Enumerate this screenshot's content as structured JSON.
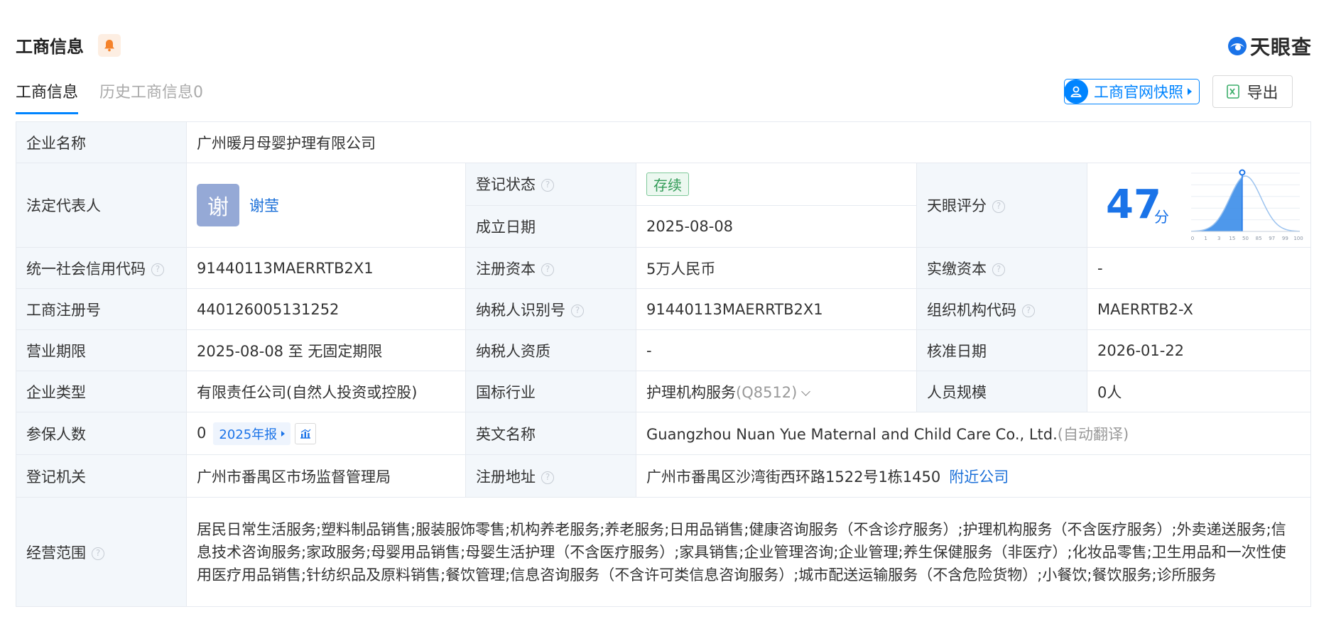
{
  "header": {
    "title": "工商信息",
    "brand": "天眼查"
  },
  "tabs": [
    {
      "label": "工商信息",
      "active": true
    },
    {
      "label": "历史工商信息0",
      "active": false
    }
  ],
  "actions": {
    "snapshot_label": "工商官网快照",
    "export_label": "导出"
  },
  "info": {
    "company_name": {
      "label": "企业名称",
      "value": "广州暖月母婴护理有限公司"
    },
    "legal_rep": {
      "label": "法定代表人",
      "avatar": "谢",
      "name": "谢莹"
    },
    "reg_status": {
      "label": "登记状态",
      "value": "存续"
    },
    "founded": {
      "label": "成立日期",
      "value": "2025-08-08"
    },
    "tianyan_score": {
      "label": "天眼评分",
      "value": "47",
      "unit": "分"
    },
    "credit_code": {
      "label": "统一社会信用代码",
      "value": "91440113MAERRTB2X1"
    },
    "reg_capital": {
      "label": "注册资本",
      "value": "5万人民币"
    },
    "paid_capital": {
      "label": "实缴资本",
      "value": "-"
    },
    "biz_reg_no": {
      "label": "工商注册号",
      "value": "440126005131252"
    },
    "taxpayer_id": {
      "label": "纳税人识别号",
      "value": "91440113MAERRTB2X1"
    },
    "org_code": {
      "label": "组织机构代码",
      "value": "MAERRTB2-X"
    },
    "biz_term": {
      "label": "营业期限",
      "value": "2025-08-08 至 无固定期限"
    },
    "taxpayer_qual": {
      "label": "纳税人资质",
      "value": "-"
    },
    "approval_date": {
      "label": "核准日期",
      "value": "2026-01-22"
    },
    "company_type": {
      "label": "企业类型",
      "value": "有限责任公司(自然人投资或控股)"
    },
    "industry": {
      "label": "国标行业",
      "value": "护理机构服务",
      "code": "(Q8512)"
    },
    "staff_size": {
      "label": "人员规模",
      "value": "0人"
    },
    "insured": {
      "label": "参保人数",
      "value": "0",
      "year_tag": "2025年报"
    },
    "english_name": {
      "label": "英文名称",
      "value": "Guangzhou Nuan Yue Maternal and Child Care Co., Ltd.",
      "note": "(自动翻译)"
    },
    "reg_authority": {
      "label": "登记机关",
      "value": "广州市番禺区市场监督管理局"
    },
    "reg_address": {
      "label": "注册地址",
      "value": "广州市番禺区沙湾街西环路1522号1栋1450",
      "link": "附近公司"
    },
    "biz_scope": {
      "label": "经营范围",
      "value": "居民日常生活服务;塑料制品销售;服装服饰零售;机构养老服务;养老服务;日用品销售;健康咨询服务（不含诊疗服务）;护理机构服务（不含医疗服务）;外卖递送服务;信息技术咨询服务;家政服务;母婴用品销售;母婴生活护理（不含医疗服务）;家具销售;企业管理咨询;企业管理;养生保健服务（非医疗）;化妆品零售;卫生用品和一次性使用医疗用品销售;针纺织品及原料销售;餐饮管理;信息咨询服务（不含许可类信息咨询服务）;城市配送运输服务（不含危险货物）;小餐饮;餐饮服务;诊所服务"
    }
  },
  "score_chart": {
    "ticks": [
      "0",
      "1",
      "3",
      "15",
      "50",
      "85",
      "97",
      "99",
      "100"
    ],
    "marker": 47,
    "colors": {
      "fill": "#2f86e8",
      "line": "#9cc3ef"
    }
  },
  "colors": {
    "accent": "#0084ff",
    "label_bg": "#f3f7fb",
    "status_green": "#2f9a55"
  }
}
